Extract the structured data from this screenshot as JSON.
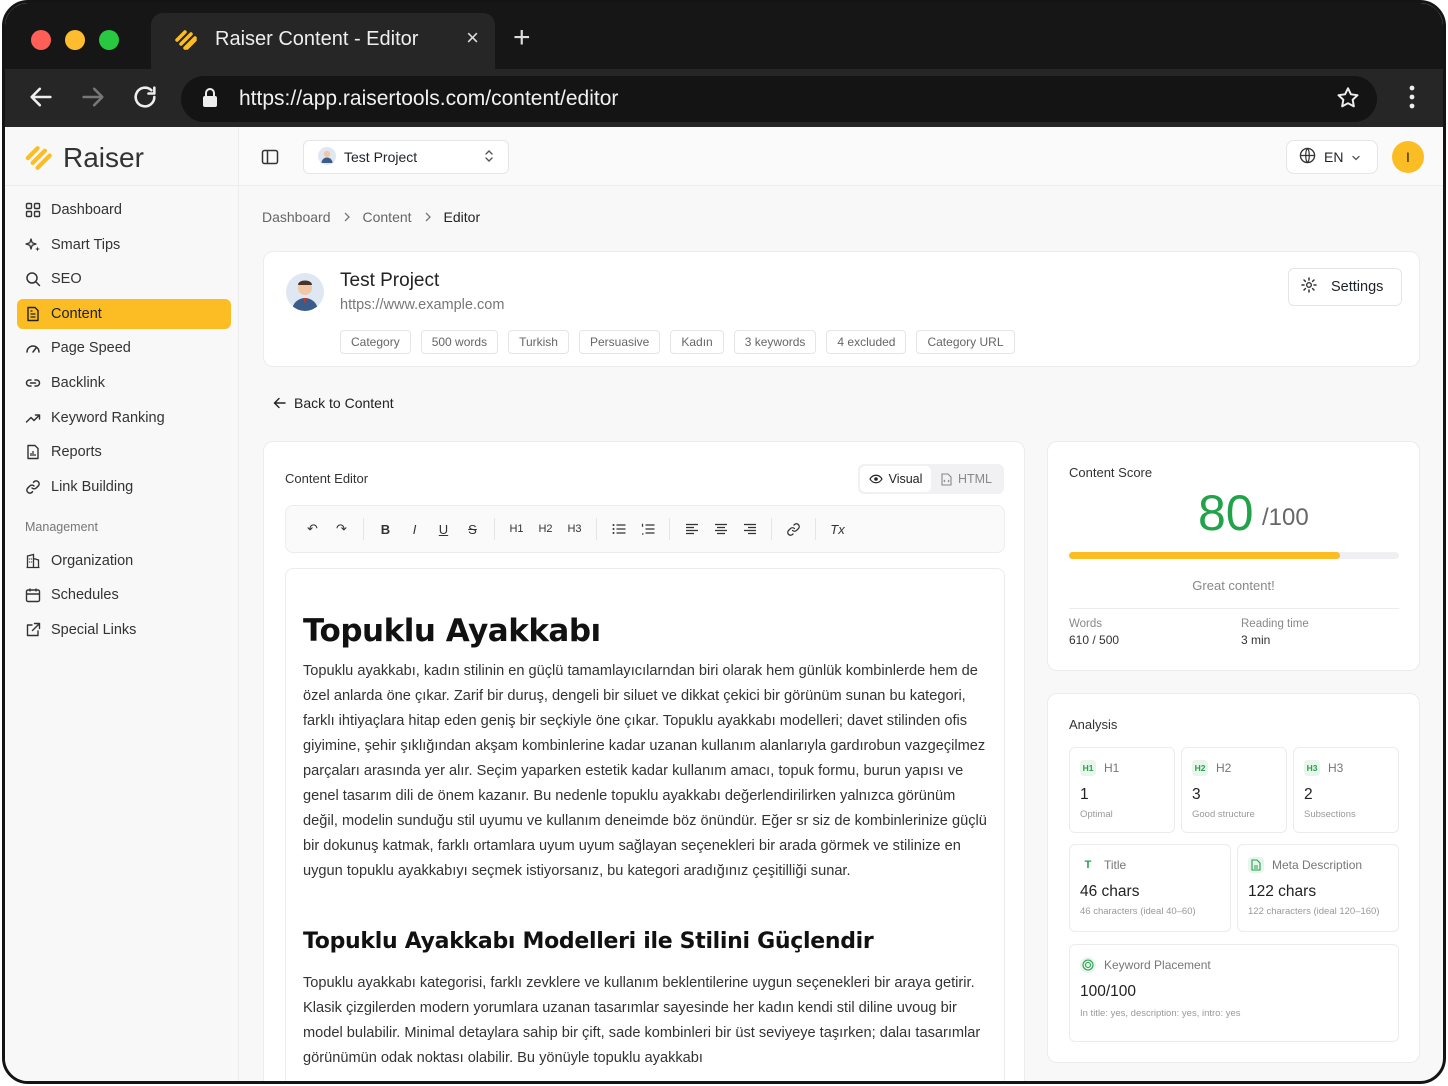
{
  "browser": {
    "tab_title": "Raiser Content - Editor",
    "url": "https://app.raisertools.com/content/editor",
    "new_tab": "+",
    "close": "×"
  },
  "brand": {
    "name": "Raiser",
    "accent": "#fbbd23"
  },
  "sidebar": {
    "items": [
      {
        "label": "Dashboard",
        "icon": "grid-icon"
      },
      {
        "label": "Smart Tips",
        "icon": "sparkles-icon"
      },
      {
        "label": "SEO",
        "icon": "search-icon"
      },
      {
        "label": "Content",
        "icon": "file-text-icon",
        "active": true
      },
      {
        "label": "Page Speed",
        "icon": "gauge-icon"
      },
      {
        "label": "Backlink",
        "icon": "link-icon"
      },
      {
        "label": "Keyword Ranking",
        "icon": "trending-up-icon"
      },
      {
        "label": "Reports",
        "icon": "report-icon"
      },
      {
        "label": "Link Building",
        "icon": "link-chain-icon"
      }
    ],
    "management_label": "Management",
    "management": [
      {
        "label": "Organization",
        "icon": "building-icon"
      },
      {
        "label": "Schedules",
        "icon": "calendar-icon"
      },
      {
        "label": "Special Links",
        "icon": "external-link-icon"
      }
    ]
  },
  "topbar": {
    "project_select": "Test Project",
    "language": "EN",
    "user_initial": "I"
  },
  "breadcrumb": [
    "Dashboard",
    "Content",
    "Editor"
  ],
  "project": {
    "title": "Test Project",
    "url": "https://www.example.com",
    "tags": [
      "Category",
      "500 words",
      "Turkish",
      "Persuasive",
      "Kadın",
      "3 keywords",
      "4 excluded",
      "Category URL"
    ],
    "settings_label": "Settings"
  },
  "back_label": "Back to Content",
  "editor": {
    "title": "Content Editor",
    "view_visual": "Visual",
    "view_html": "HTML",
    "toolbar": {
      "undo": "↶",
      "redo": "↷",
      "bold": "B",
      "italic": "I",
      "underline": "U",
      "strike": "S",
      "h1": "H1",
      "h2": "H2",
      "h3": "H3",
      "clear": "Tx"
    },
    "doc": {
      "h1": "Topuklu Ayakkabı",
      "p1": "Topuklu ayakkabı, kadın stilinin en güçlü tamamlayıcılarndan biri olarak hem günlük kombinlerde hem de özel anlarda öne çıkar. Zarif bir duruş, dengeli bir siluet ve dikkat çekici bir görünüm sunan bu kategori, farklı ihtiyaçlara hitap eden geniş bir seçkiyle öne çıkar. Topuklu ayakkabı modelleri; davet stilinden ofis giyimine, şehir şıklığından akşam kombinlerine kadar uzanan kullanım alanlarıyla gardırobun vazgeçilmez parçaları arasında yer alır. Seçim yaparken estetik kadar kullanım amacı, topuk formu, burun yapısı ve genel tasarım dili de önem kazanır. Bu nedenle topuklu ayakkabı değerlendirilirken yalnızca görünüm değil, modelin sunduğu stil uyumu ve kullanım deneimde böz önündür. Eğer sr siz de kombinlerinize güçlü bir dokunuş katmak, farklı ortamlara uyum uyum sağlayan seçenekleri bir arada görmek ve stilinize en uygun topuklu ayakkabıyı seçmek istiyorsanız, bu kategori aradığınız çeşitilliği sunar.",
      "h2": "Topuklu Ayakkabı Modelleri ile Stilini Güçlendir",
      "p2": "Topuklu ayakkabı kategorisi, farklı zevklere ve kullanım beklentilerine uygun seçenekleri bir araya getirir. Klasik çizgilerden modern yorumlara uzanan tasarımlar sayesinde her kadın kendi stil diline uvoug bir model bulabilir. Minimal detaylara sahip bir çift, sade kombinleri bir üst seviyeye taşırken; dalaı tasarımlar görünümün odak noktası olabilir. Bu yönüyle topuklu ayakkabı"
    }
  },
  "score": {
    "label": "Content Score",
    "value": "80",
    "max": "/100",
    "progress": 0.82,
    "message": "Great content!",
    "words_label": "Words",
    "words_value": "610 / 500",
    "reading_label": "Reading time",
    "reading_value": "3 min",
    "color": "#22a34a"
  },
  "analysis": {
    "title": "Analysis",
    "h1": {
      "icon": "H1",
      "label": "H1",
      "value": "1",
      "sub": "Optimal"
    },
    "h2": {
      "icon": "H2",
      "label": "H2",
      "value": "3",
      "sub": "Good structure"
    },
    "h3": {
      "icon": "H3",
      "label": "H3",
      "value": "2",
      "sub": "Subsections"
    },
    "title_metric": {
      "icon": "T",
      "label": "Title",
      "value": "46 chars",
      "sub": "46 characters (ideal 40–60)"
    },
    "meta": {
      "label": "Meta Description",
      "value": "122 chars",
      "sub": "122 characters (ideal 120–160)"
    },
    "keyword": {
      "label": "Keyword Placement",
      "value": "100/100",
      "sub": "In title: yes, description: yes, intro: yes"
    }
  }
}
